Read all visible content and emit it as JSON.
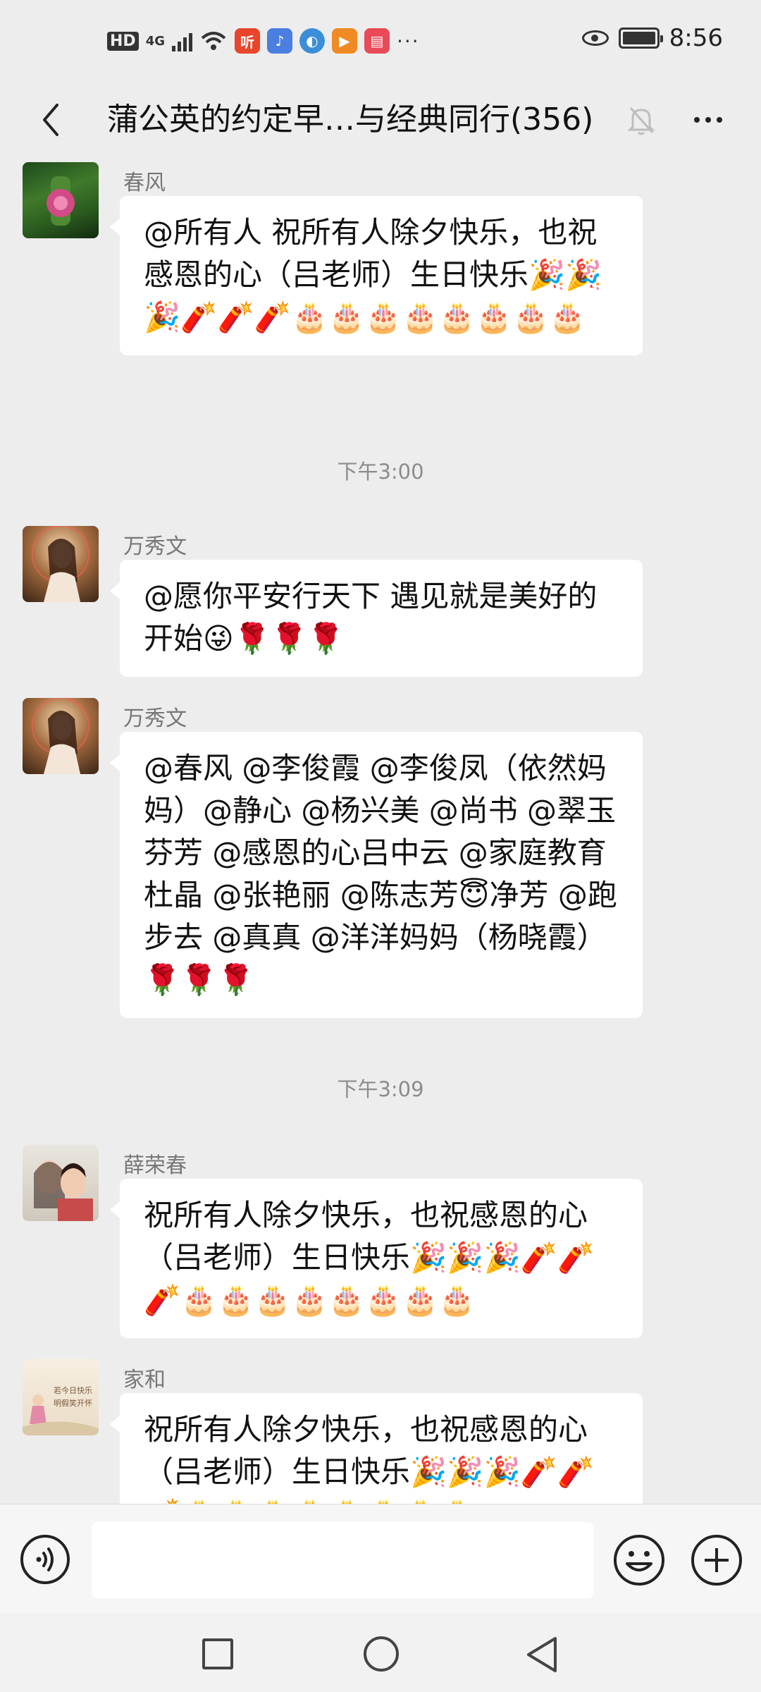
{
  "status_bar": {
    "hd": "HD",
    "network": "4G",
    "time": "8:56",
    "more_dots": "···",
    "app_icons": [
      {
        "name": "ting-app-icon",
        "label": "听",
        "color": "#e8452c"
      },
      {
        "name": "music-app-icon",
        "label": "♪",
        "color": "#4a7ee0"
      },
      {
        "name": "browser-app-icon",
        "label": "◐",
        "color": "#3b8fd9"
      },
      {
        "name": "video-app-icon",
        "label": "▶",
        "color": "#f08a24"
      },
      {
        "name": "reader-app-icon",
        "label": "▤",
        "color": "#e94a58"
      }
    ]
  },
  "header": {
    "title": "蒲公英的约定早…与经典同行(356)"
  },
  "messages": [
    {
      "sender": "春风",
      "text": "@所有人  祝所有人除夕快乐，也祝感恩的心（吕老师）生日快乐🎉🎉🎉🧨🧨🧨🎂🎂🎂🎂🎂🎂🎂🎂"
    },
    {
      "sender": "万秀文",
      "text": "@愿你平安行天下  遇见就是美好的开始😜🌹🌹🌹"
    },
    {
      "sender": "万秀文",
      "text": "@春风 @李俊霞 @李俊凤（依然妈妈）@静心 @杨兴美 @尚书 @翠玉芬芳 @感恩的心吕中云 @家庭教育杜晶 @张艳丽 @陈志芳😇净芳 @跑步去 @真真 @洋洋妈妈（杨晓霞） 🌹🌹🌹"
    },
    {
      "sender": "薛荣春",
      "text": "祝所有人除夕快乐，也祝感恩的心（吕老师）生日快乐🎉🎉🎉🧨🧨🧨🎂🎂🎂🎂🎂🎂🎂🎂"
    },
    {
      "sender": "家和",
      "text": "祝所有人除夕快乐，也祝感恩的心（吕老师）生日快乐🎉🎉🎉🧨🧨🧨🎂🎂🎂🎂🎂🎂🎂🎂",
      "avatar_text": "若今日快乐 明假笑开怀"
    }
  ],
  "timestamps": [
    "下午3:00",
    "下午3:09"
  ],
  "input": {
    "placeholder": ""
  },
  "colors": {
    "background": "#ededed",
    "bubble": "#ffffff",
    "input_bar": "#f6f6f6"
  }
}
